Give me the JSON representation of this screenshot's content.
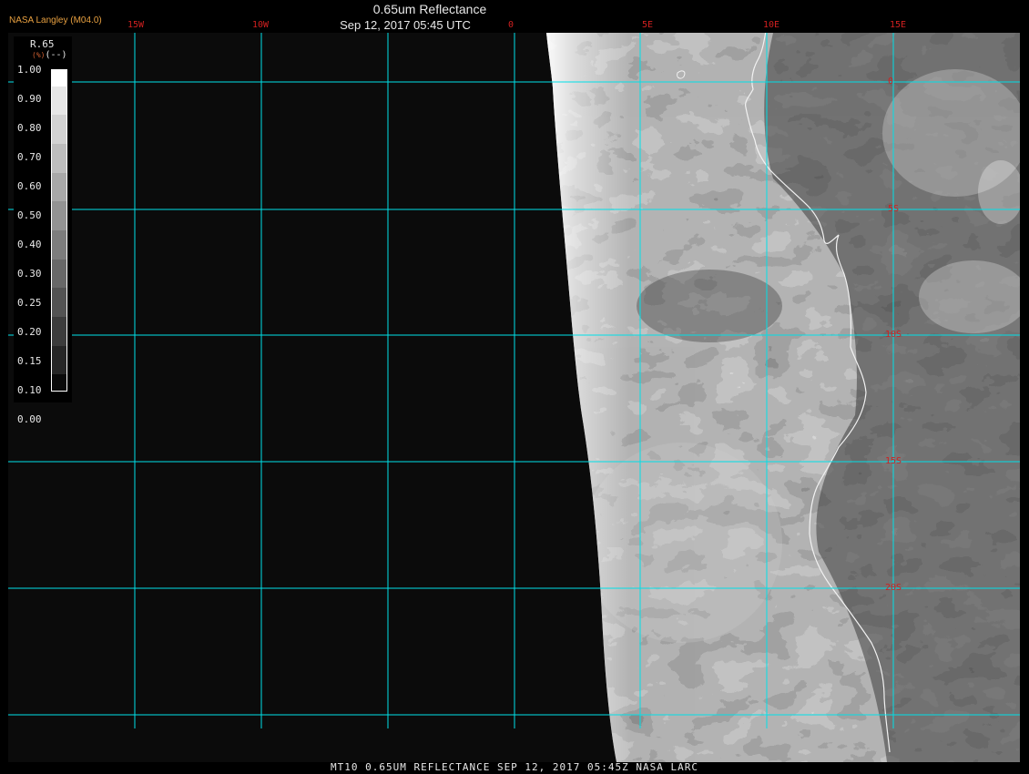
{
  "header": {
    "title": "0.65um Reflectance",
    "datetime": "Sep 12, 2017 05:45 UTC",
    "producer": "NASA Langley (M04.0)"
  },
  "map": {
    "longitude_labels": [
      "15W",
      "10W",
      "0",
      "5E",
      "10E",
      "15E"
    ],
    "latitude_labels": [
      "0",
      "5S",
      "10S",
      "15S",
      "20S"
    ],
    "grid_color": "#00e0e8",
    "label_color": "#d02020",
    "coast_color": "#ffffff"
  },
  "legend": {
    "name": "R.65",
    "units": "(--)",
    "unit_prefix": "(%)",
    "ticks": [
      "1.00",
      "0.90",
      "0.80",
      "0.70",
      "0.60",
      "0.50",
      "0.40",
      "0.30",
      "0.25",
      "0.20",
      "0.15",
      "0.10",
      "0.00"
    ]
  },
  "footer": {
    "caption": "MT10  0.65UM REFLECTANCE   SEP 12, 2017 05:45Z   NASA LARC"
  }
}
